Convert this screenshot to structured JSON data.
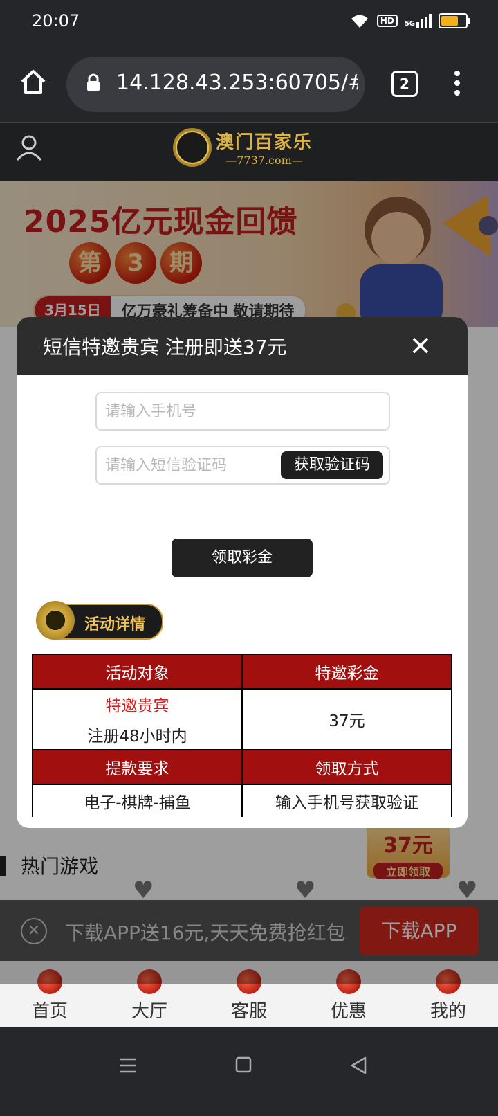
{
  "status_bar": {
    "time": "20:07",
    "hd": "HD",
    "network": "5G"
  },
  "browser": {
    "url": "14.128.43.253:60705/#/",
    "tab_count": "2"
  },
  "site": {
    "logo_main": "澳门百家乐",
    "logo_sub": "—7737.com—"
  },
  "banner": {
    "headline": "2025亿元现金回馈",
    "period": [
      "第",
      "3",
      "期"
    ],
    "date": "3月15日",
    "message": "亿万豪礼筹备中 敬请期待"
  },
  "modal": {
    "title": "短信特邀贵宾 注册即送37元",
    "phone_placeholder": "请输入手机号",
    "code_placeholder": "请输入短信验证码",
    "get_code_label": "获取验证码",
    "claim_label": "领取彩金",
    "detail_badge": "活动详情",
    "table": {
      "headers1": [
        "活动对象",
        "特邀彩金"
      ],
      "target_line1": "特邀贵宾",
      "target_line2": "注册48小时内",
      "bonus": "37元",
      "headers2": [
        "提款要求",
        "领取方式"
      ],
      "requirement": "电子-棋牌-捕鱼",
      "method": "输入手机号获取验证"
    }
  },
  "page": {
    "hot_games": "热门游戏",
    "promo_amount": "37元",
    "promo_btn": "立即领取"
  },
  "download_bar": {
    "text": "下载APP送16元,天天免费抢红包",
    "button": "下载APP"
  },
  "bottom_nav": [
    {
      "label": "首页"
    },
    {
      "label": "大厅"
    },
    {
      "label": "客服"
    },
    {
      "label": "优惠"
    },
    {
      "label": "我的"
    }
  ],
  "colors": {
    "header_red": "#a20f0f",
    "accent_red": "#d11f1f",
    "gold": "#d9b24a"
  }
}
